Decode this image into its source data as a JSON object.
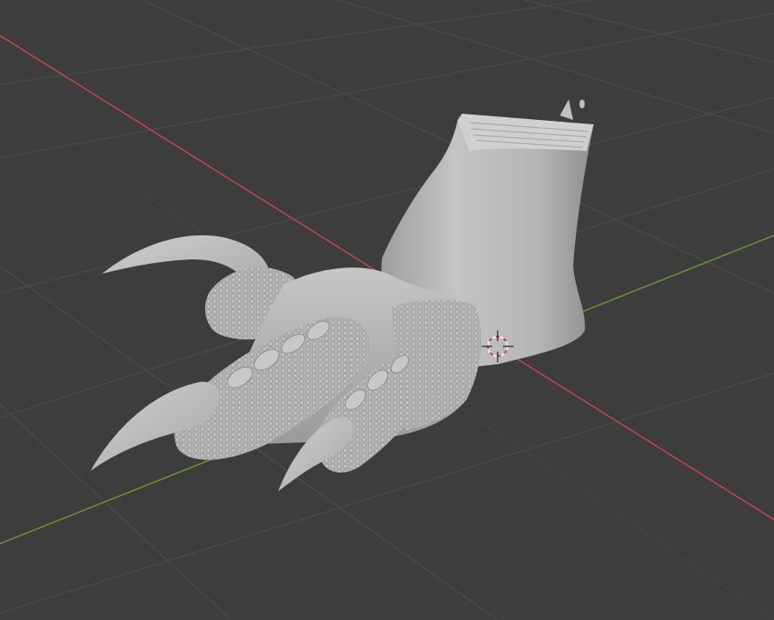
{
  "viewport": {
    "background": "#3d3d3d",
    "grid_color": "#4a4a4a",
    "x_axis_color": "#c9454f",
    "y_axis_color": "#6d9a2c",
    "mesh_color": "#bdbdbd",
    "cursor_colors": [
      "#d23c3c",
      "#eeeeee"
    ]
  },
  "object": {
    "type": "sculpted-mesh",
    "shading": "solid-matcap"
  }
}
